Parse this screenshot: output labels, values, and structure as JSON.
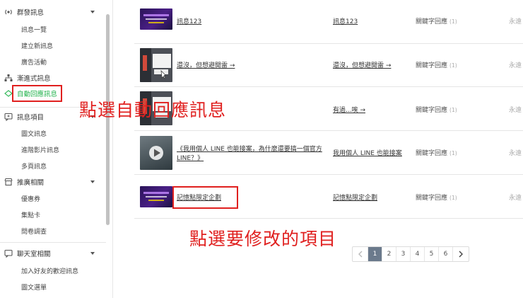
{
  "sidebar": {
    "groups": [
      {
        "label": "群發訊息",
        "icon": "broadcast-icon"
      },
      {
        "label": "漸進式訊息",
        "icon": "hierarchy-icon"
      },
      {
        "label": "自動回應訊息",
        "icon": "auto-reply-icon"
      },
      {
        "label": "訊息項目",
        "icon": "message-item-icon"
      },
      {
        "label": "推廣相關",
        "icon": "shop-icon"
      },
      {
        "label": "聊天室相關",
        "icon": "chat-icon"
      }
    ],
    "items": {
      "broadcast": [
        "訊息一覽",
        "建立新訊息",
        "廣告活動"
      ],
      "message_items": [
        "圖文訊息",
        "進階影片訊息",
        "多頁訊息"
      ],
      "promotion": [
        "優惠券",
        "集點卡",
        "問卷調查"
      ],
      "chat": [
        "加入好友的歡迎訊息",
        "圖文選單"
      ]
    }
  },
  "annotations": {
    "click_auto_reply": "點選自動回應訊息",
    "click_item_to_edit": "點選要修改的項目"
  },
  "rows": [
    {
      "title": "訊息123",
      "keyword": "訊息123",
      "type": "關鍵字回應",
      "count": "(1)",
      "period": "永遠"
    },
    {
      "title": "還沒，但想避開雷 →",
      "keyword": "還沒，但想避開雷 →",
      "type": "關鍵字回應",
      "count": "(1)",
      "period": "永遠"
    },
    {
      "title": "",
      "keyword": "有過...唉 →",
      "type": "關鍵字回應",
      "count": "(1)",
      "period": "永遠"
    },
    {
      "title_line1": "《我用個人 LINE 也能接案，為什麼還要搞一個官方",
      "title_line2": "LINE？》",
      "keyword": "我用個人 LINE 也能接案",
      "type": "關鍵字回應",
      "count": "(1)",
      "period": "永遠"
    },
    {
      "title": "記憶點限定企劃",
      "keyword": "記憶點限定企劃",
      "type": "關鍵字回應",
      "count": "(1)",
      "period": "永遠"
    }
  ],
  "pagination": {
    "pages": [
      "1",
      "2",
      "3",
      "4",
      "5",
      "6"
    ],
    "current": "1",
    "prev_icon": "chevron-left-icon",
    "next_icon": "chevron-right-icon"
  },
  "colors": {
    "active_green": "#21b24b",
    "annotation_red": "#e0201f",
    "pager_active": "#6b7a8c"
  }
}
